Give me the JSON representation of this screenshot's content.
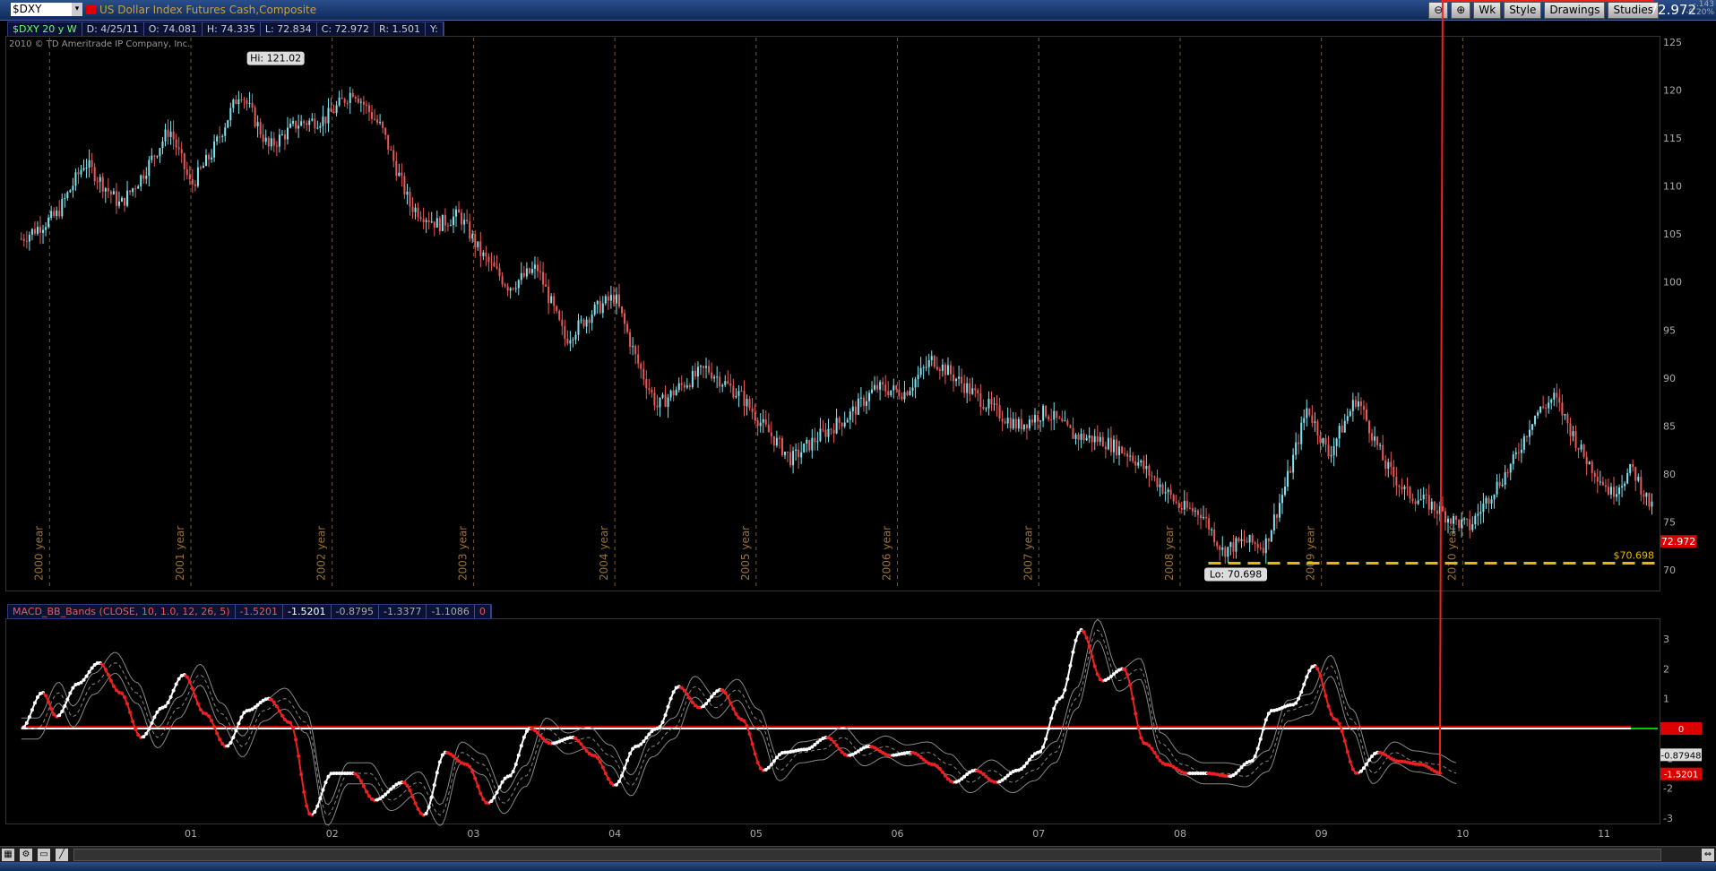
{
  "toolbar": {
    "symbol": "$DXY",
    "description": "US Dollar Index Futures Cash,Composite",
    "buttons": [
      "Wk",
      "Style",
      "Drawings",
      "Studies"
    ],
    "last_price": "72.972",
    "change_abs": "-.143",
    "change_pct": "-0.20%"
  },
  "infobar": {
    "symbol_period": "$DXY 20 y W",
    "date": "D: 4/25/11",
    "open": "O: 74.081",
    "high": "H: 74.335",
    "low": "L: 72.834",
    "close": "C: 72.972",
    "range": "R: 1.501",
    "y": "Y:"
  },
  "copyright": "2010 © TD Ameritrade IP Company, Inc.",
  "macd_label": {
    "name": "MACD_BB_Bands (CLOSE, 10, 1.0, 12, 26, 5)",
    "v1": "-1.5201",
    "v2": "-1.5201",
    "v3": "-0.8795",
    "v4": "-1.3377",
    "v5": "-1.1086",
    "v6": "0"
  },
  "colors": {
    "up_bar": "#7fe4f0",
    "down_bar": "#e85a5a",
    "year_line": "#7a5a30",
    "low_line": "#e8b800",
    "zero_line": "#cc0000",
    "macd_up": "#ffffff",
    "macd_down": "#ee2020"
  },
  "chart_data": [
    {
      "type": "candlestick",
      "title": "$DXY 20 y W",
      "ylim": [
        70,
        125
      ],
      "yticks": [
        70,
        75,
        80,
        85,
        90,
        95,
        100,
        105,
        110,
        115,
        120,
        125
      ],
      "year_labels": [
        "2000 year",
        "2001 year",
        "2002 year",
        "2003 year",
        "2004 year",
        "2005 year",
        "2006 year",
        "2007 year",
        "2008 year",
        "2009 year",
        "2010 year"
      ],
      "annotations": {
        "high_label": "Hi: 121.02",
        "low_label": "Lo: 70.698",
        "low_line_value": "$70.698",
        "low_value": 70.698,
        "price_tag": "72.972"
      },
      "x": [
        1999.75,
        2000.0,
        2000.2,
        2000.45,
        2000.6,
        2000.8,
        2000.95,
        2001.1,
        2001.3,
        2001.5,
        2001.7,
        2001.9,
        2002.1,
        2002.3,
        2002.5,
        2002.7,
        2002.85,
        2003.0,
        2003.2,
        2003.4,
        2003.6,
        2003.8,
        2003.95,
        2004.1,
        2004.25,
        2004.4,
        2004.6,
        2004.85,
        2005.0,
        2005.2,
        2005.4,
        2005.6,
        2005.8,
        2006.0,
        2006.2,
        2006.4,
        2006.6,
        2006.8,
        2007.0,
        2007.2,
        2007.4,
        2007.6,
        2007.8,
        2007.95,
        2008.1,
        2008.25,
        2008.4,
        2008.55,
        2008.7,
        2008.85,
        2009.0,
        2009.2,
        2009.4,
        2009.55,
        2009.7,
        2009.9,
        2010.0,
        2010.15,
        2010.3,
        2010.45,
        2010.6,
        2010.8,
        2011.0,
        2011.15,
        2011.3
      ],
      "close": [
        104.5,
        107,
        112.5,
        108,
        111,
        116,
        110,
        113.5,
        120,
        114,
        116.5,
        117,
        120,
        116,
        108,
        106,
        107,
        103,
        99.5,
        101.5,
        94,
        97,
        98.5,
        92,
        87,
        89,
        91,
        88,
        85,
        81.5,
        84,
        86,
        89,
        88.5,
        92,
        89.5,
        87,
        85,
        86.5,
        84,
        83.5,
        82,
        79,
        76.5,
        76,
        72,
        73,
        72.5,
        79,
        87,
        82,
        88,
        81,
        78,
        77,
        75,
        74.5,
        78,
        81,
        86,
        88,
        82,
        78,
        80.5,
        76,
        73
      ]
    },
    {
      "type": "line",
      "title": "MACD_BB_Bands (CLOSE, 10, 1.0, 12, 26, 5)",
      "ylim": [
        -3,
        3
      ],
      "yticks": [
        -3,
        -2,
        -1,
        0,
        1,
        2,
        3
      ],
      "xtick_labels": [
        "01",
        "02",
        "03",
        "04",
        "05",
        "06",
        "07",
        "08",
        "09",
        "10",
        "11"
      ],
      "value_tags": [
        "0",
        "-0.87948",
        "-1.5201"
      ],
      "x": [
        1999.75,
        1999.9,
        2000.0,
        2000.15,
        2000.3,
        2000.45,
        2000.6,
        2000.75,
        2000.9,
        2001.05,
        2001.2,
        2001.35,
        2001.5,
        2001.65,
        2001.8,
        2001.95,
        2002.1,
        2002.25,
        2002.45,
        2002.6,
        2002.75,
        2002.9,
        2003.05,
        2003.2,
        2003.35,
        2003.5,
        2003.65,
        2003.8,
        2003.95,
        2004.1,
        2004.25,
        2004.4,
        2004.55,
        2004.7,
        2004.85,
        2005.0,
        2005.15,
        2005.3,
        2005.45,
        2005.6,
        2005.75,
        2005.9,
        2006.05,
        2006.2,
        2006.35,
        2006.5,
        2006.65,
        2006.8,
        2006.95,
        2007.1,
        2007.25,
        2007.4,
        2007.55,
        2007.7,
        2007.85,
        2008.0,
        2008.15,
        2008.3,
        2008.45,
        2008.6,
        2008.75,
        2008.9,
        2009.05,
        2009.2,
        2009.35,
        2009.5,
        2009.65,
        2009.8,
        2009.95,
        2010.1,
        2010.25,
        2010.4,
        2010.55,
        2010.7,
        2010.85,
        2011.0,
        2011.15,
        2011.3
      ],
      "series": [
        {
          "values": [
            0.0,
            1.2,
            0.4,
            1.5,
            2.2,
            1.2,
            -0.3,
            0.7,
            1.8,
            0.5,
            -0.6,
            0.6,
            1.0,
            0.2,
            -2.9,
            -1.5,
            -1.5,
            -2.4,
            -1.8,
            -2.9,
            -0.8,
            -1.2,
            -2.5,
            -1.6,
            0.0,
            -0.5,
            -0.3,
            -0.9,
            -1.9,
            -0.6,
            0.0,
            1.4,
            0.7,
            1.3,
            0.3,
            -1.4,
            -0.8,
            -0.7,
            -0.3,
            -0.9,
            -0.6,
            -0.9,
            -0.8,
            -1.2,
            -1.8,
            -1.4,
            -1.8,
            -1.4,
            -0.8,
            1.0,
            3.3,
            1.6,
            2.0,
            -0.5,
            -1.2,
            -1.5,
            -1.5,
            -1.6,
            -1.1,
            0.6,
            0.8,
            2.1,
            0.3,
            -1.5,
            -0.8,
            -1.1,
            -1.2,
            -1.5
          ]
        }
      ]
    }
  ]
}
